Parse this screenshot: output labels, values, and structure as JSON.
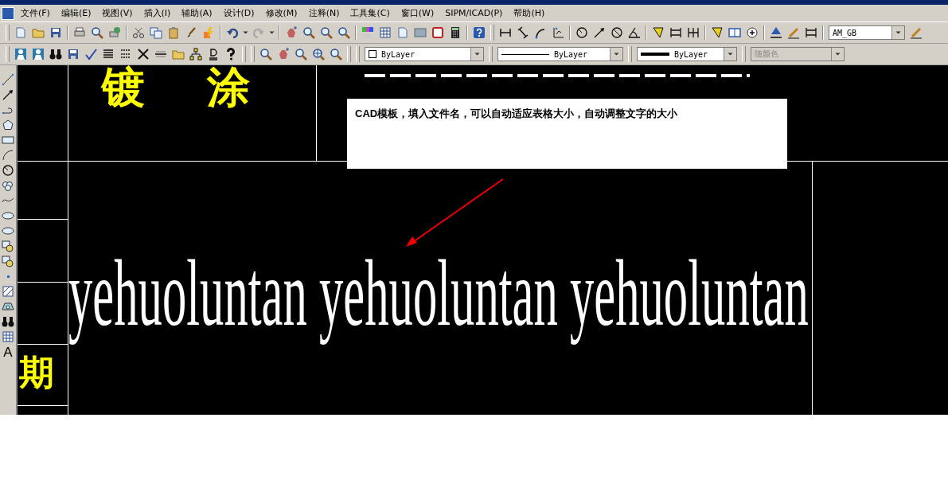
{
  "menu": [
    {
      "label": "文件(F)"
    },
    {
      "label": "编辑(E)"
    },
    {
      "label": "视图(V)"
    },
    {
      "label": "插入(I)"
    },
    {
      "label": "辅助(A)"
    },
    {
      "label": "设计(D)"
    },
    {
      "label": "修改(M)"
    },
    {
      "label": "注释(N)"
    },
    {
      "label": "工具集(C)"
    },
    {
      "label": "窗口(W)"
    },
    {
      "label": "SIPM/ICAD(P)"
    },
    {
      "label": "帮助(H)"
    }
  ],
  "toolbar": {
    "style_combo": {
      "value": "AM_GB",
      "disabled": false
    },
    "property_combos": [
      {
        "kind": "layer",
        "value": "ByLayer",
        "disabled": false
      },
      {
        "kind": "linetype",
        "value": "ByLayer",
        "disabled": false
      },
      {
        "kind": "lineweight",
        "value": "ByLayer",
        "disabled": false
      },
      {
        "kind": "color",
        "value": "随颜色",
        "disabled": true
      }
    ]
  },
  "draw_tools": {
    "text_tool_glyph": "A"
  },
  "drawing": {
    "title_chars": [
      "镀",
      "涂"
    ],
    "side_char": "期",
    "callout": "CAD模板，填入文件名，可以自动适应表格大小，自动调整文字的大小",
    "big_text": "yehuoluntan yehuoluntan yehuoluntan"
  }
}
